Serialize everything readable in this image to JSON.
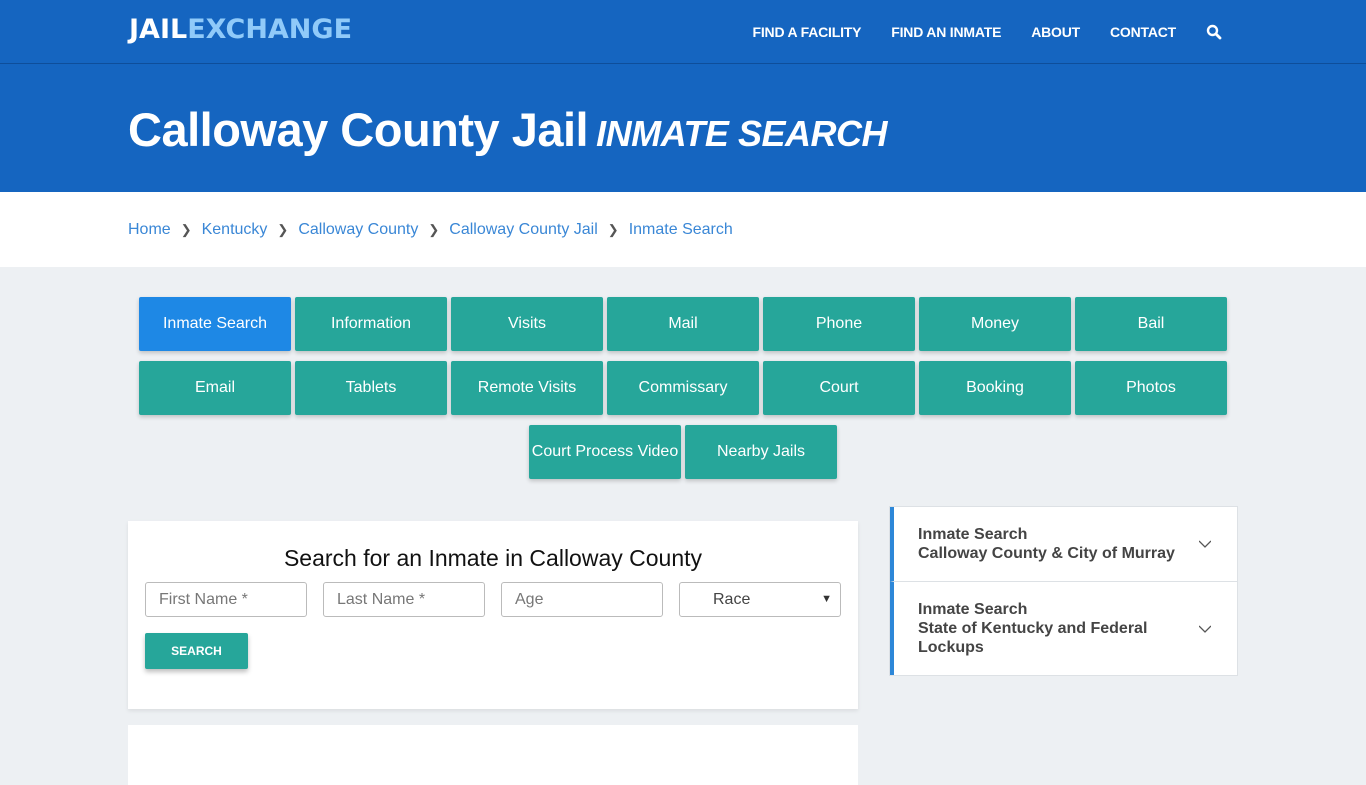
{
  "header": {
    "logo_part1": "JAIL",
    "logo_part2": "EXCHANGE",
    "nav": [
      "FIND A FACILITY",
      "FIND AN INMATE",
      "ABOUT",
      "CONTACT"
    ],
    "search_icon": "search-icon"
  },
  "hero": {
    "title": "Calloway County Jail",
    "subtitle": "INMATE SEARCH"
  },
  "breadcrumb": [
    "Home",
    "Kentucky",
    "Calloway County",
    "Calloway County Jail",
    "Inmate Search"
  ],
  "buttons": {
    "row1": [
      "Inmate Search",
      "Information",
      "Visits",
      "Mail",
      "Phone",
      "Money",
      "Bail"
    ],
    "row2": [
      "Email",
      "Tablets",
      "Remote Visits",
      "Commissary",
      "Court",
      "Booking",
      "Photos"
    ],
    "row3": [
      "Court Process Video",
      "Nearby Jails"
    ],
    "active": "Inmate Search"
  },
  "search_form": {
    "title": "Search for an Inmate in Calloway County",
    "first_name_placeholder": "First Name *",
    "last_name_placeholder": "Last Name *",
    "age_placeholder": "Age",
    "race_selected": "Race",
    "submit_label": "SEARCH"
  },
  "sidebar": [
    {
      "title": "Inmate Search",
      "subtitle": "Calloway County & City of Murray"
    },
    {
      "title": "Inmate Search",
      "subtitle": "State of Kentucky and Federal Lockups"
    }
  ]
}
